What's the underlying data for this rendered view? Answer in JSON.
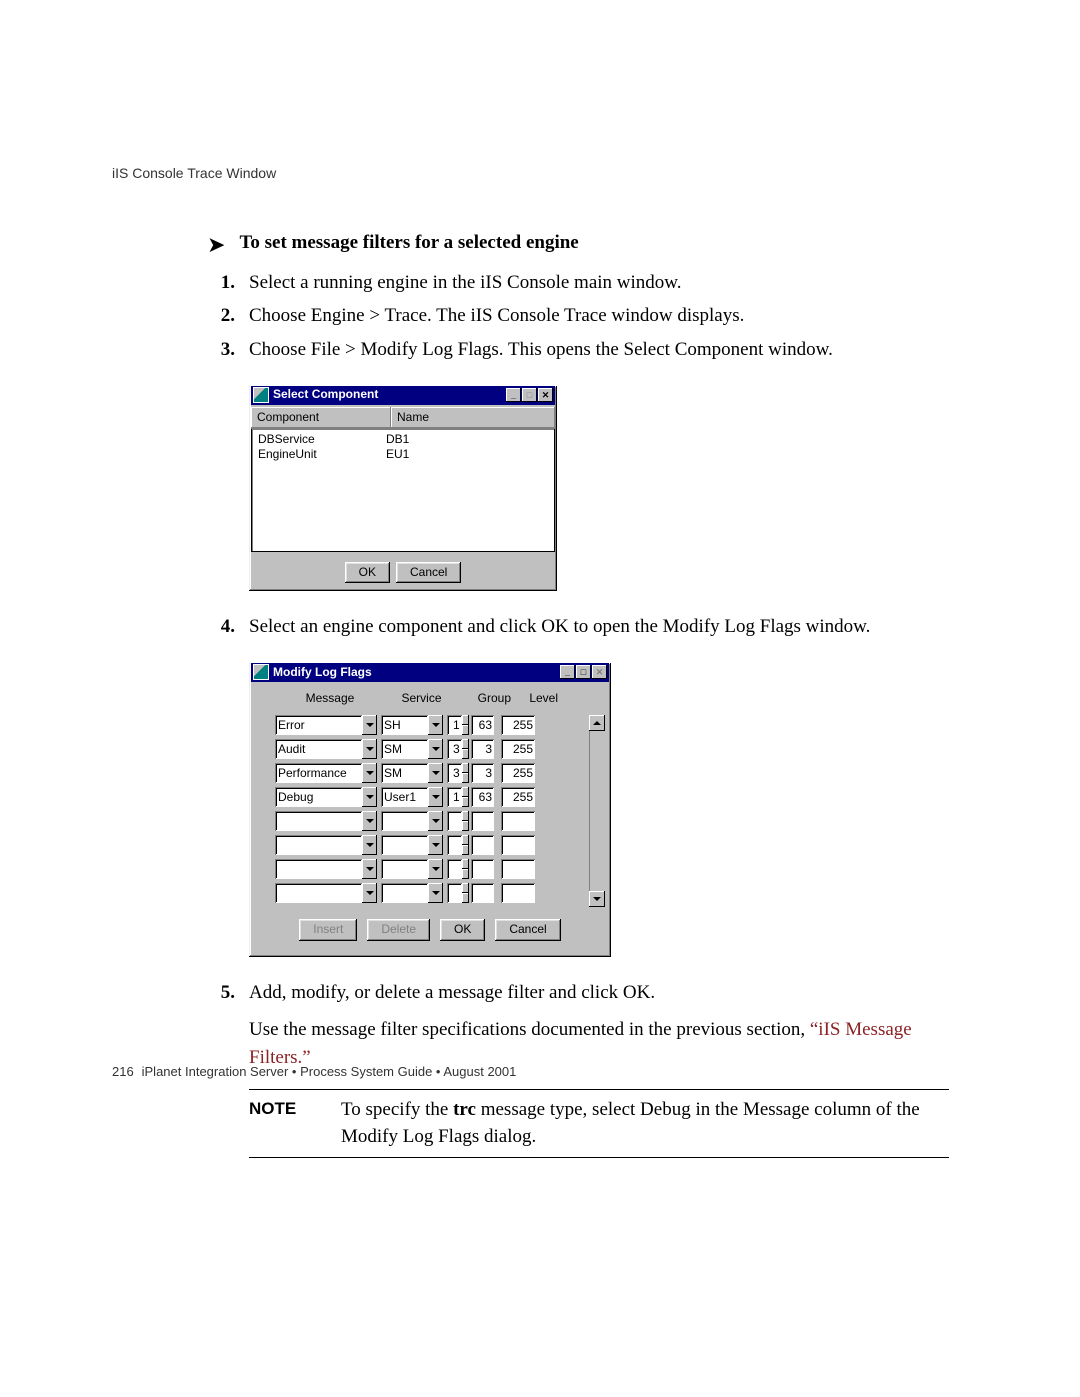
{
  "header": {
    "running": "iIS Console Trace Window"
  },
  "heading": "To set message filters for a selected engine",
  "steps": {
    "s1": {
      "n": "1.",
      "t": "Select a running engine in the iIS Console main window."
    },
    "s2": {
      "n": "2.",
      "t": "Choose Engine > Trace. The iIS Console Trace window displays."
    },
    "s3": {
      "n": "3.",
      "t": "Choose File > Modify Log Flags. This opens the Select Component window."
    },
    "s4": {
      "n": "4.",
      "t": "Select an engine component and click OK to open the Modify Log Flags window."
    },
    "s5": {
      "n": "5.",
      "t": "Add, modify, or delete a message filter and click OK."
    },
    "s5b_a": "Use the message filter specifications documented in the previous section, ",
    "s5b_link": "“iIS Message Filters.”"
  },
  "note": {
    "label": "NOTE",
    "pre": "To specify the ",
    "bold": "trc",
    "post": " message type, select Debug in the Message column of the Modify Log Flags dialog."
  },
  "footer": {
    "page": "216",
    "text": "iPlanet Integration Server • Process System Guide • August 2001"
  },
  "sc": {
    "title": "Select Component",
    "head_component": "Component",
    "head_name": "Name",
    "rows": [
      {
        "component": "DBService",
        "name": "DB1"
      },
      {
        "component": "EngineUnit",
        "name": "EU1"
      }
    ],
    "ok": "OK",
    "cancel": "Cancel"
  },
  "ml": {
    "title": "Modify Log Flags",
    "head_message": "Message",
    "head_service": "Service",
    "head_group": "Group",
    "head_level": "Level",
    "rows": [
      {
        "msg": "Error",
        "svc": "SH",
        "g1": "1",
        "g2": "63",
        "lv": "255"
      },
      {
        "msg": "Audit",
        "svc": "SM",
        "g1": "3",
        "g2": "3",
        "lv": "255"
      },
      {
        "msg": "Performance",
        "svc": "SM",
        "g1": "3",
        "g2": "3",
        "lv": "255"
      },
      {
        "msg": "Debug",
        "svc": "User1",
        "g1": "1",
        "g2": "63",
        "lv": "255"
      },
      {
        "msg": "",
        "svc": "",
        "g1": "",
        "g2": "",
        "lv": ""
      },
      {
        "msg": "",
        "svc": "",
        "g1": "",
        "g2": "",
        "lv": ""
      },
      {
        "msg": "",
        "svc": "",
        "g1": "",
        "g2": "",
        "lv": ""
      },
      {
        "msg": "",
        "svc": "",
        "g1": "",
        "g2": "",
        "lv": ""
      }
    ],
    "insert": "Insert",
    "delete": "Delete",
    "ok": "OK",
    "cancel": "Cancel"
  }
}
